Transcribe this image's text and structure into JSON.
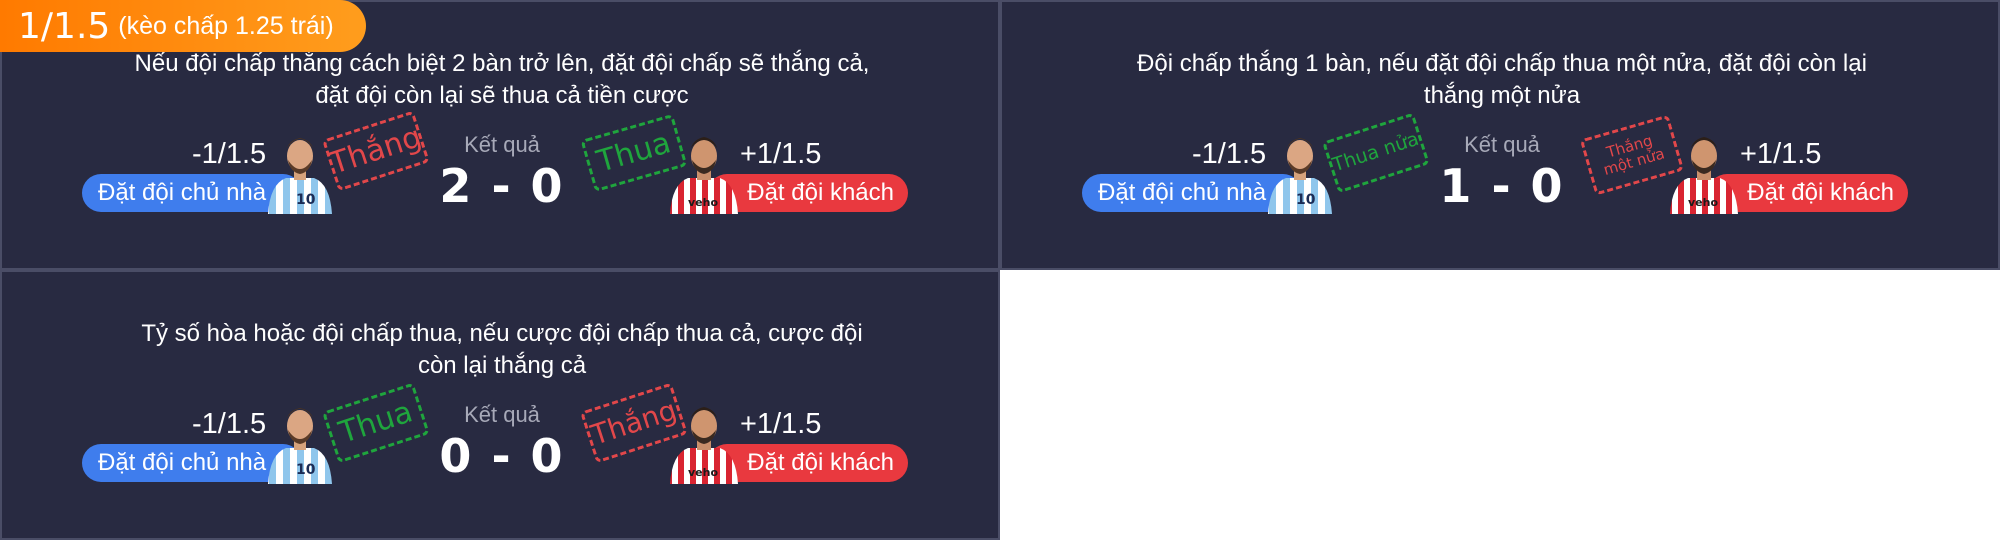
{
  "badge": {
    "main": "1/1.5",
    "sub": "(kèo chấp 1.25 trái)"
  },
  "common": {
    "home_odds": "-1/1.5",
    "away_odds": "+1/1.5",
    "home_label": "Đặt đội chủ nhà",
    "away_label": "Đặt đội khách",
    "result_label": "Kết quả"
  },
  "panels": [
    {
      "desc": "Nếu đội chấp thắng cách biệt 2 bàn trở lên, đặt đội chấp sẽ thắng cả, đặt đội còn lại sẽ thua cả tiền cược",
      "score": "2 - 0",
      "home_stamp": "Thắng",
      "away_stamp": "Thua"
    },
    {
      "desc": "Đội chấp thắng 1 bàn, nếu đặt đội chấp thua một nửa, đặt đội còn lại thắng một nửa",
      "score": "1 - 0",
      "home_stamp": "Thua nửa",
      "away_stamp": "Thắng một nửa"
    },
    {
      "desc": "Tỷ số hòa hoặc đội chấp thua, nếu cược đội chấp thua cả, cược đội còn lại thắng cả",
      "score": "0 - 0",
      "home_stamp": "Thua",
      "away_stamp": "Thắng"
    }
  ],
  "colors": {
    "panel_bg": "#282a41",
    "home_pill": "#3f7ded",
    "away_pill": "#e9393f",
    "stamp_win": "#e2474a",
    "stamp_lose": "#1fa53d",
    "badge": "#ff8a00"
  }
}
